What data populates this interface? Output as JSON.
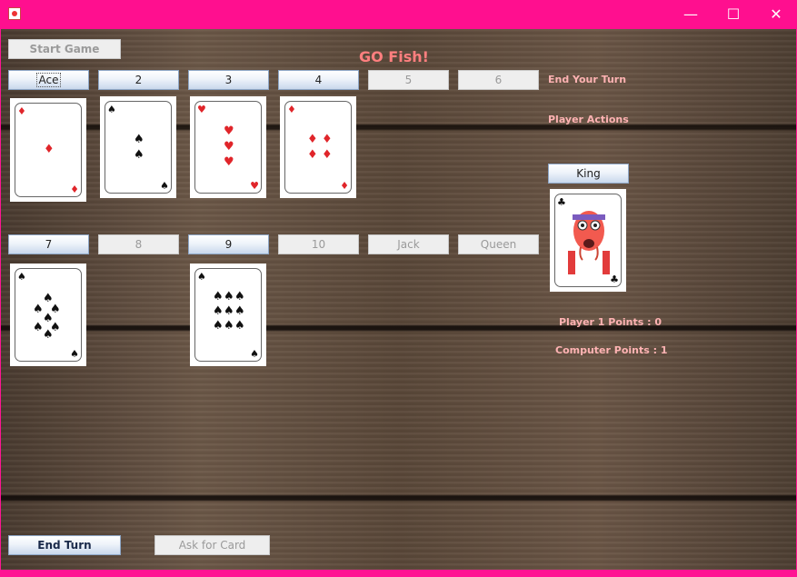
{
  "window": {
    "icon": "java-icon",
    "minimize": "—",
    "maximize": "☐",
    "close": "✕"
  },
  "title": "GO Fish!",
  "toolbar": {
    "start_game": "Start Game"
  },
  "rank_buttons_row1": [
    "Ace",
    "2",
    "3",
    "4",
    "5",
    "6"
  ],
  "rank_buttons_row2": [
    "7",
    "8",
    "9",
    "10",
    "Jack",
    "Queen"
  ],
  "side": {
    "end_your_turn": "End Your Turn",
    "player_actions": "Player Actions",
    "king_button": "King",
    "player_points": "Player 1 Points : 0",
    "computer_points": "Computer Points : 1"
  },
  "bottom": {
    "end_turn": "End Turn",
    "ask_for_card": "Ask for Card"
  },
  "cards": {
    "ace": {
      "suit": "diamonds",
      "pip": "♦"
    },
    "two": {
      "suit": "spades",
      "pip": "♠"
    },
    "three": {
      "suit": "hearts",
      "pip": "♥"
    },
    "four": {
      "suit": "diamonds",
      "pip": "♦"
    },
    "seven": {
      "suit": "spades",
      "pip": "♠"
    },
    "nine": {
      "suit": "spades",
      "pip": "♠"
    },
    "king": {
      "suit": "clubs",
      "pip": "♣"
    }
  },
  "colors": {
    "accent": "#ff1493",
    "title": "#ff7f7f",
    "label": "#ffb3b3"
  }
}
